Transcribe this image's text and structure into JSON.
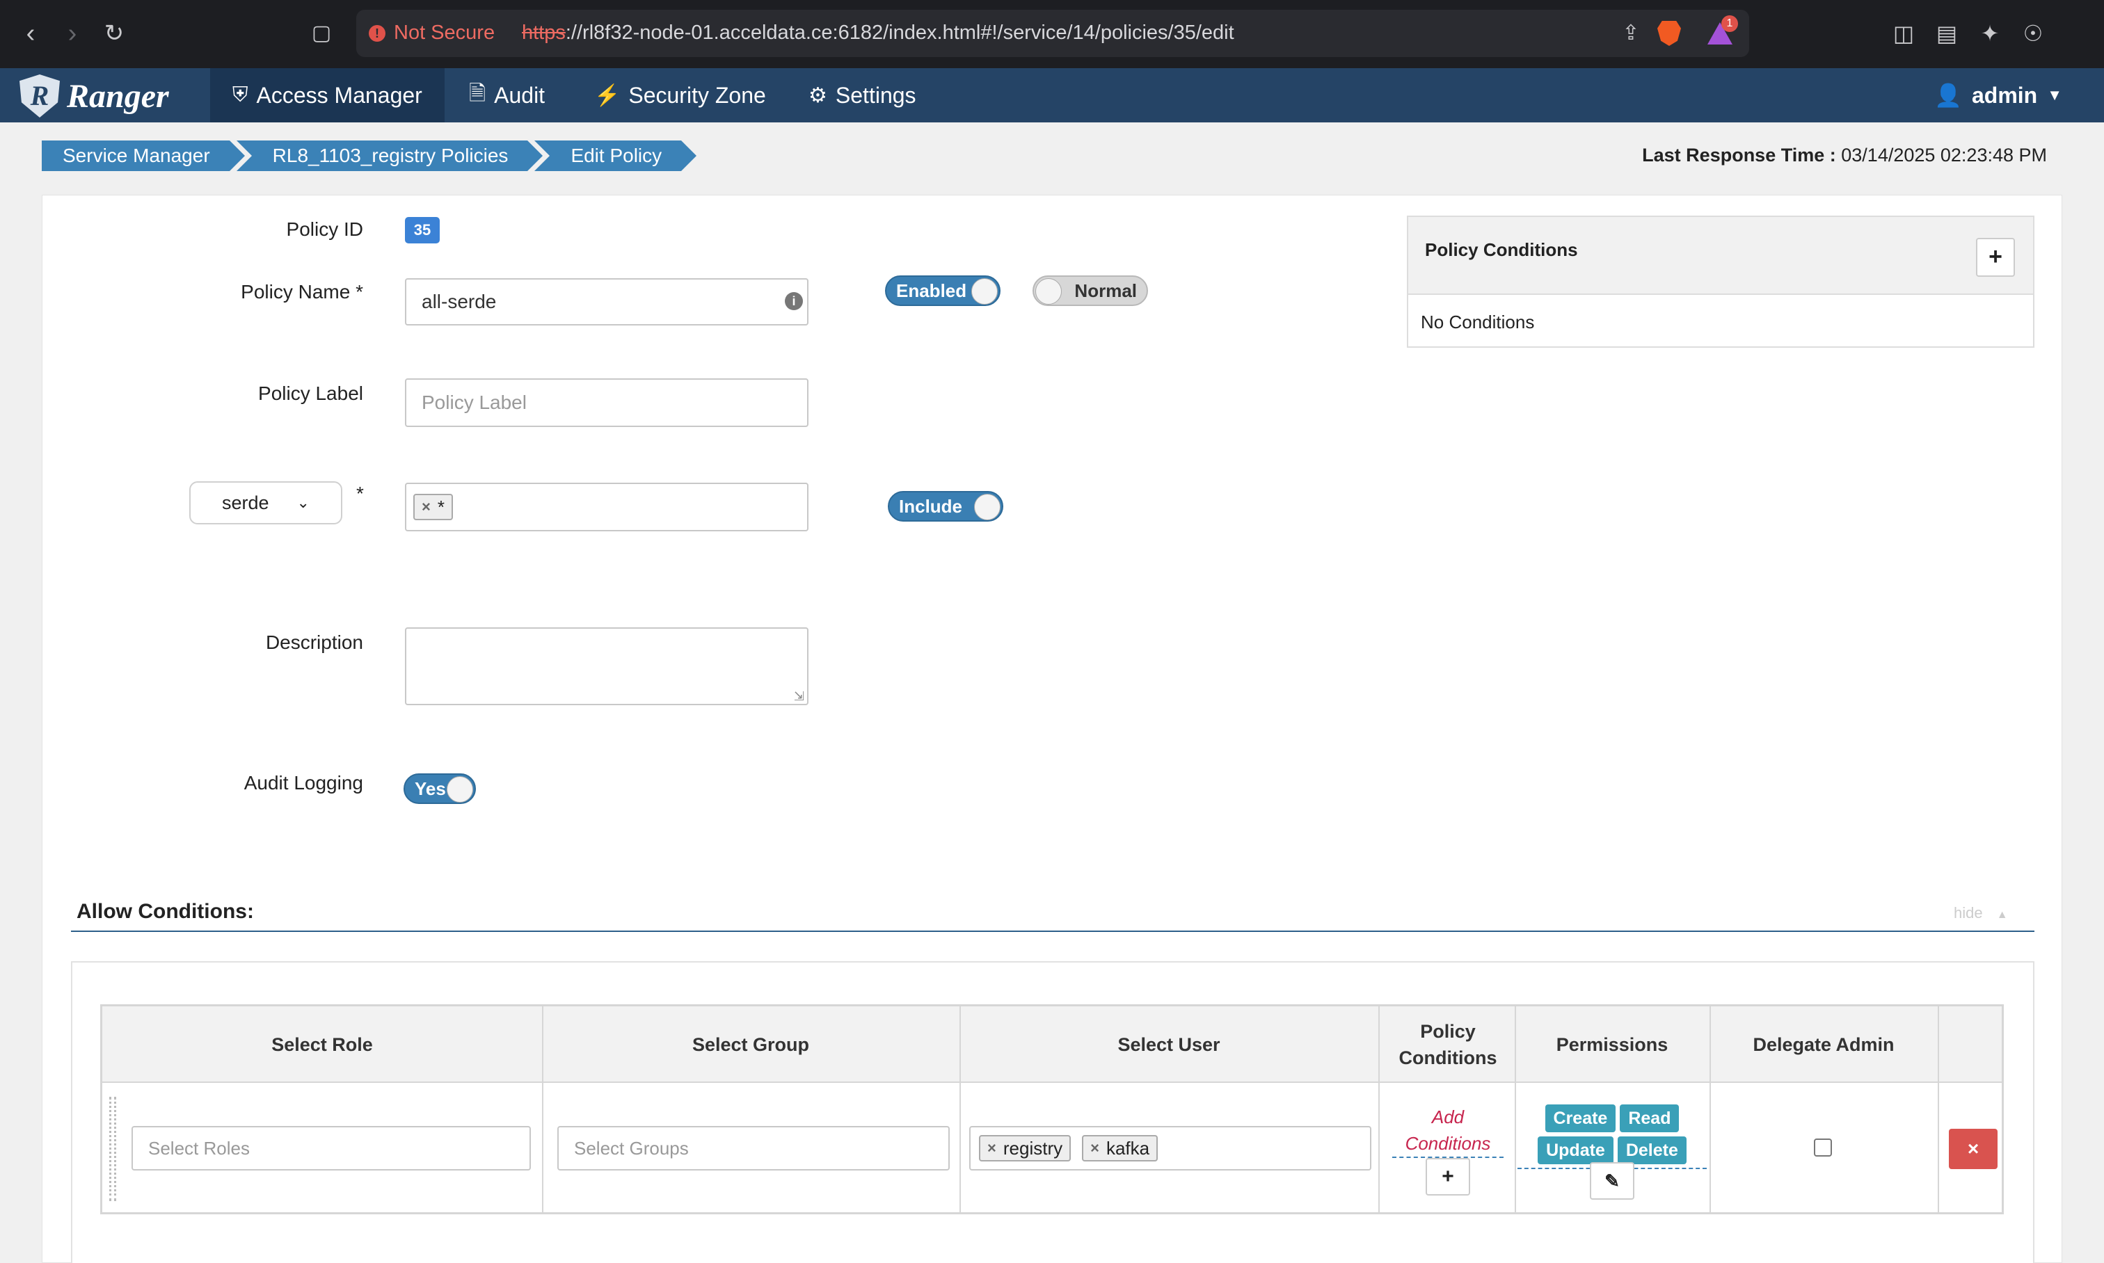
{
  "browser": {
    "not_secure": "Not Secure",
    "url_scheme": "https",
    "url_rest": "://rl8f32-node-01.acceldata.ce:6182/index.html#!/service/14/policies/35/edit",
    "notification_count": "1"
  },
  "navbar": {
    "logo": "Ranger",
    "items": [
      {
        "label": "Access Manager",
        "icon": "shield-icon"
      },
      {
        "label": "Audit",
        "icon": "file-icon"
      },
      {
        "label": "Security Zone",
        "icon": "zone-icon"
      },
      {
        "label": "Settings",
        "icon": "gear-icon"
      }
    ],
    "user": "admin"
  },
  "breadcrumb": [
    "Service Manager",
    "RL8_1103_registry Policies",
    "Edit Policy"
  ],
  "last_response": {
    "label": "Last Response Time :",
    "value": "03/14/2025 02:23:48 PM"
  },
  "form": {
    "policy_id_label": "Policy ID",
    "policy_id": "35",
    "policy_name_label": "Policy Name *",
    "policy_name": "all-serde",
    "enabled_label": "Enabled",
    "normal_label": "Normal",
    "policy_label_label": "Policy Label",
    "policy_label_placeholder": "Policy Label",
    "resource_type": "serde",
    "resource_required": "*",
    "resource_values": [
      "*"
    ],
    "include_label": "Include",
    "description_label": "Description",
    "audit_logging_label": "Audit Logging",
    "audit_logging_value": "Yes"
  },
  "policy_conditions": {
    "title": "Policy Conditions",
    "empty_text": "No Conditions"
  },
  "allow_conditions": {
    "title": "Allow Conditions:",
    "hide_label": "hide",
    "columns": [
      "Select Role",
      "Select Group",
      "Select User",
      "Policy Conditions",
      "Permissions",
      "Delegate Admin"
    ],
    "row": {
      "roles_placeholder": "Select Roles",
      "groups_placeholder": "Select Groups",
      "users": [
        "registry",
        "kafka"
      ],
      "add_conditions": "Add Conditions",
      "permissions": [
        "Create",
        "Read",
        "Update",
        "Delete"
      ],
      "delegate_admin": false
    }
  }
}
